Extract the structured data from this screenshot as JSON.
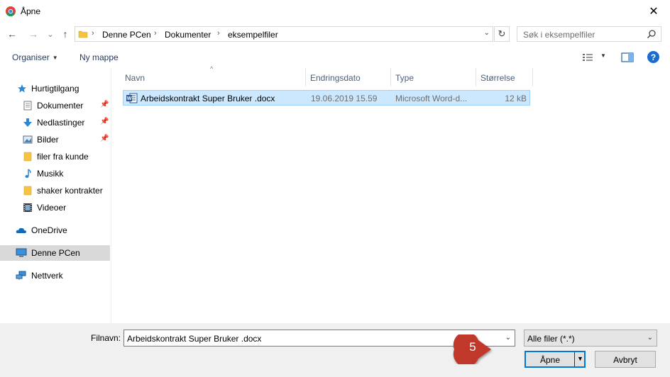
{
  "window": {
    "title": "Åpne",
    "close_glyph": "✕"
  },
  "nav": {
    "back_glyph": "←",
    "forward_glyph": "→",
    "recent_glyph": "⌄",
    "up_glyph": "↑",
    "breadcrumbs": [
      "Denne PCen",
      "Dokumenter",
      "eksempelfiler"
    ],
    "separator": "›",
    "dropdown_glyph": "⌄",
    "refresh_glyph": "↻",
    "search_placeholder": "Søk i eksempelfiler"
  },
  "toolbar": {
    "organize_label": "Organiser",
    "organize_arrow": "▼",
    "new_folder_label": "Ny mappe",
    "view_arrow": "▼",
    "help_label": "?"
  },
  "sidebar": {
    "pin_glyph": "📌",
    "items": [
      {
        "label": "Hurtigtilgang",
        "icon": "star-icon"
      },
      {
        "label": "Dokumenter",
        "icon": "documents-icon",
        "pinned": true
      },
      {
        "label": "Nedlastinger",
        "icon": "download-icon",
        "pinned": true
      },
      {
        "label": "Bilder",
        "icon": "pictures-icon",
        "pinned": true
      },
      {
        "label": "filer fra kunde",
        "icon": "folder-icon"
      },
      {
        "label": "Musikk",
        "icon": "music-icon"
      },
      {
        "label": "shaker kontrakter",
        "icon": "folder-icon"
      },
      {
        "label": "Videoer",
        "icon": "video-icon"
      },
      {
        "label": "OneDrive",
        "icon": "cloud-icon"
      },
      {
        "label": "Denne PCen",
        "icon": "computer-icon",
        "selected": true
      },
      {
        "label": "Nettverk",
        "icon": "network-icon"
      }
    ]
  },
  "file_list": {
    "sort_glyph": "^",
    "columns": [
      "Navn",
      "Endringsdato",
      "Type",
      "Størrelse"
    ],
    "rows": [
      {
        "name": "Arbeidskontrakt Super Bruker .docx",
        "date": "19.06.2019 15.59",
        "type": "Microsoft Word-d...",
        "size": "12 kB",
        "selected": true
      }
    ]
  },
  "footer": {
    "filename_label": "Filnavn:",
    "filename_value": "Arbeidskontrakt Super Bruker .docx",
    "filename_drop": "⌄",
    "filetype_value": "Alle filer (*.*)",
    "filetype_drop": "⌄",
    "open_label": "Åpne",
    "open_drop": "▼",
    "cancel_label": "Avbryt"
  },
  "annotation": {
    "step_number": "5",
    "color": "#c0392b"
  },
  "colors": {
    "selection_bg": "#cce8ff",
    "selection_border": "#99d1ff",
    "accent": "#0078d7",
    "folder": "#f5c242"
  }
}
